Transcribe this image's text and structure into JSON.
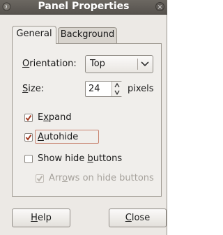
{
  "window": {
    "title": "Panel Properties",
    "menu_icon": "window-menu-icon",
    "close_icon": "window-close-icon",
    "close_glyph": "×"
  },
  "tabs": [
    {
      "label": "General",
      "active": true
    },
    {
      "label": "Background",
      "active": false
    }
  ],
  "orientation": {
    "mnemonic": "O",
    "rest": "rientation:",
    "value": "Top"
  },
  "size": {
    "mnemonic": "S",
    "rest": "ize:",
    "value": "24",
    "unit": "pixels"
  },
  "expand": {
    "pre": "E",
    "mnemonic": "x",
    "rest": "pand",
    "checked": true
  },
  "autohide": {
    "mnemonic": "A",
    "rest": "utohide",
    "checked": true
  },
  "show_hide_buttons": {
    "pre": "Show hide ",
    "mnemonic": "b",
    "rest": "uttons",
    "checked": false
  },
  "arrows": {
    "pre": "Arr",
    "mnemonic": "o",
    "rest": "ws on hide buttons",
    "checked": true,
    "disabled": true
  },
  "buttons": {
    "help": {
      "mnemonic": "H",
      "rest": "elp"
    },
    "close": {
      "mnemonic": "C",
      "rest": "lose"
    }
  },
  "colors": {
    "titlebar": "#56524d",
    "dialog_bg": "#ece9e5",
    "check": "#a33a22",
    "focus": "#c8826e"
  }
}
